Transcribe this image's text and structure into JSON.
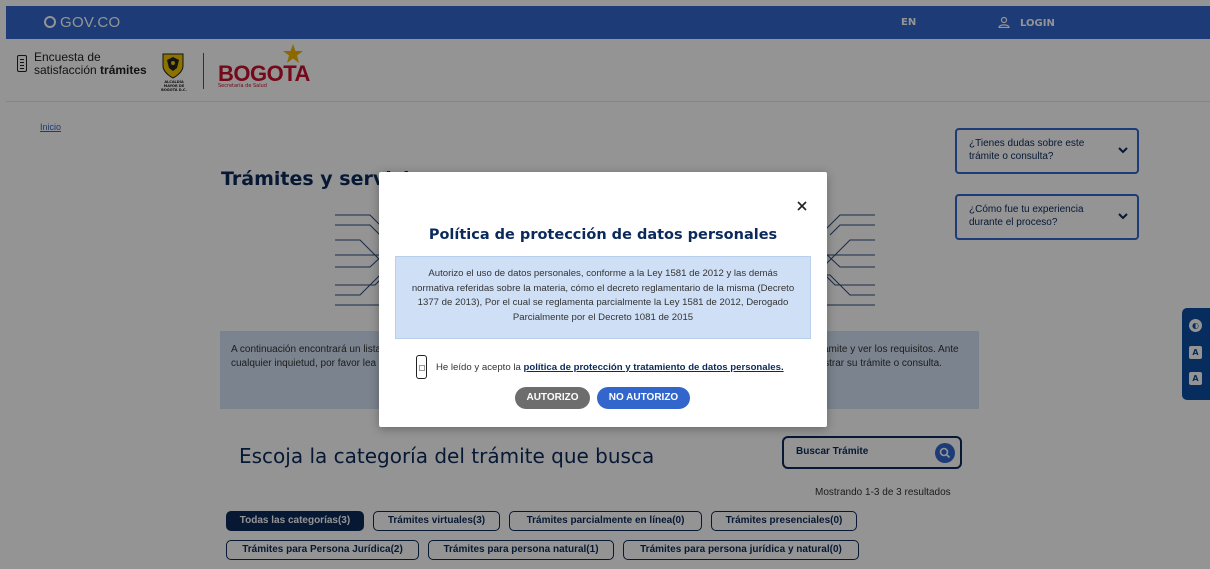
{
  "govbar": {
    "logo": "GOV.CO",
    "lang": "EN",
    "login": "LOGIN"
  },
  "header": {
    "survey_line1": "Encuesta de",
    "survey_line2_a": "satisfacción ",
    "survey_line2_b": "trámites",
    "alcaldia": "ALCALDÍA MAYOR DE BOGOTÁ D.C.",
    "brand": "BOGOTA",
    "brand_sub": "Secretaría de Salud"
  },
  "breadcrumb": "Inicio",
  "page_title": "Trámites y servicios",
  "accordions": [
    {
      "label": "¿Tienes dudas sobre este trámite o consulta?"
    },
    {
      "label": "¿Cómo fue tu experiencia durante el proceso?"
    }
  ],
  "info_text": "A continuación encontrará un listado de trámites. Para ver los requisitos, por favor lea atentamente la información antes de iniciar el trámite y ver los requisitos. Ante cualquier inquietud, por favor lea atentamente la información del trámite con el fin de evitar reprocesos y demoras en la gestión al registrar su trámite o consulta.",
  "category_title": "Escoja la categoría del trámite que busca",
  "search": {
    "placeholder": "Buscar Trámite"
  },
  "results_text": "Mostrando 1-3 de 3 resultados",
  "categories": [
    "Todas las categorías(3)",
    "Trámites virtuales(3)",
    "Trámites parcialmente en línea(0)",
    "Trámites presenciales(0)",
    "Trámites para Persona Jurídica(2)",
    "Trámites para persona natural(1)",
    "Trámites para persona jurídica y natural(0)"
  ],
  "modal": {
    "title": "Política de protección de datos personales",
    "body": "Autorizo el uso de datos personales, conforme a la Ley 1581 de 2012 y las demás normativa referidas sobre la materia, cómo el decreto reglamentario de la misma (Decreto 1377 de 2013), Por el cual se reglamenta parcialmente la Ley 1581 de 2012, Derogado Parcialmente por el Decreto 1081 de 2015",
    "accept_prefix": "He leído y acepto la ",
    "accept_link": "política de protección y tratamiento de datos personales.",
    "btn_yes": "AUTORIZO",
    "btn_no": "NO AUTORIZO"
  },
  "colors": {
    "gov_blue": "#3366cc",
    "navy": "#0b2a5b",
    "brand_red": "#c8102e",
    "info_bg": "#cfe0f6"
  }
}
